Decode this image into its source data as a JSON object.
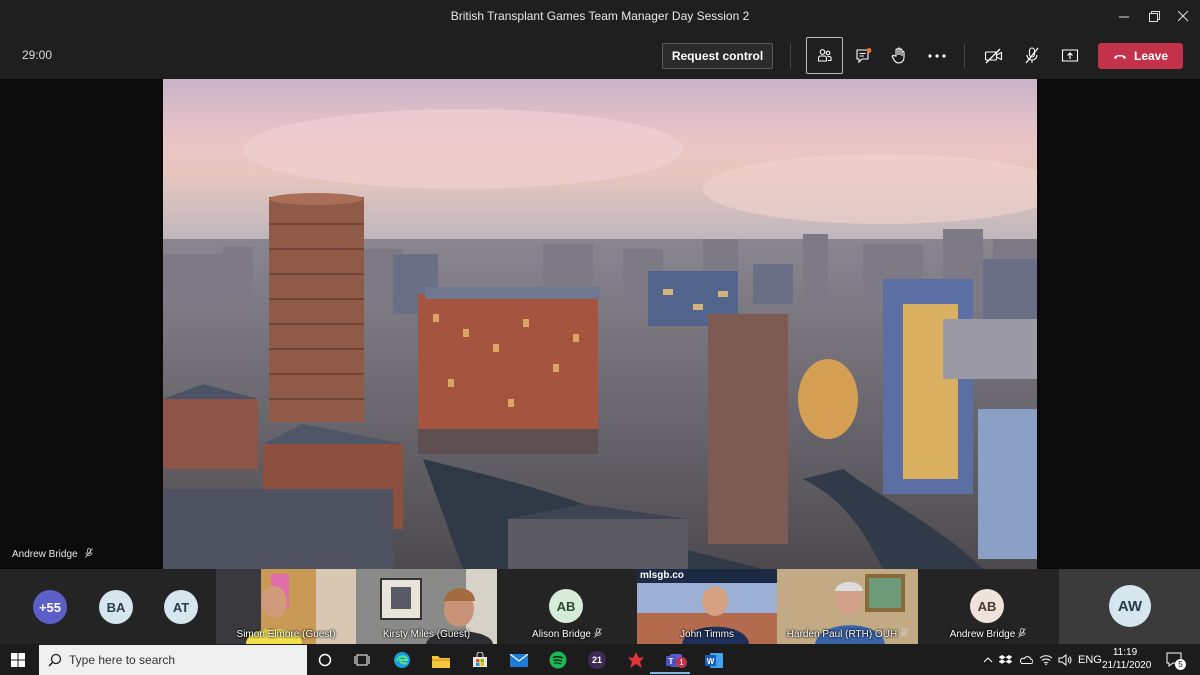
{
  "window": {
    "title": "British Transplant Games Team Manager Day Session 2",
    "controls": [
      "minimize-icon",
      "restore-icon",
      "close-icon"
    ]
  },
  "toolbar": {
    "timer": "29:00",
    "request_control_label": "Request control",
    "icons": [
      "participants-icon",
      "chat-icon",
      "raise-hand-icon",
      "more-icon",
      "camera-off-icon",
      "mic-off-icon",
      "share-icon"
    ],
    "leave_label": "Leave",
    "leave_color": "#c4314b"
  },
  "stage": {
    "presenter_name": "Andrew Bridge"
  },
  "participants": {
    "overflow_label": "+55",
    "overflow_color": "#5b5fc7",
    "avatars": [
      {
        "initials": "BA"
      },
      {
        "initials": "AT"
      }
    ],
    "tiles": [
      {
        "name": "Simon Elmore (Guest)",
        "type": "video"
      },
      {
        "name": "Kirsty Miles (Guest)",
        "type": "video"
      },
      {
        "name": "Alison Bridge",
        "type": "avatar",
        "initials": "AB"
      },
      {
        "name": "John Timms",
        "type": "video",
        "overlay_text": "mlsgb.co"
      },
      {
        "name": "Harden Paul (RTH) OUH",
        "type": "video"
      },
      {
        "name": "Andrew Bridge",
        "type": "avatar",
        "initials": "AB"
      }
    ],
    "self_initials": "AW"
  },
  "taskbar": {
    "search_placeholder": "Type here to search",
    "apps": [
      "cortana-icon",
      "task-view-icon",
      "edge-icon",
      "file-explorer-icon",
      "store-icon",
      "mail-icon",
      "spotify-icon",
      "app-21-icon",
      "app-red-icon",
      "teams-icon",
      "word-icon"
    ],
    "app21_label": "21",
    "teams_badge": "1",
    "language": "ENG",
    "time": "11:19",
    "date": "21/11/2020",
    "notification_count": "5"
  }
}
